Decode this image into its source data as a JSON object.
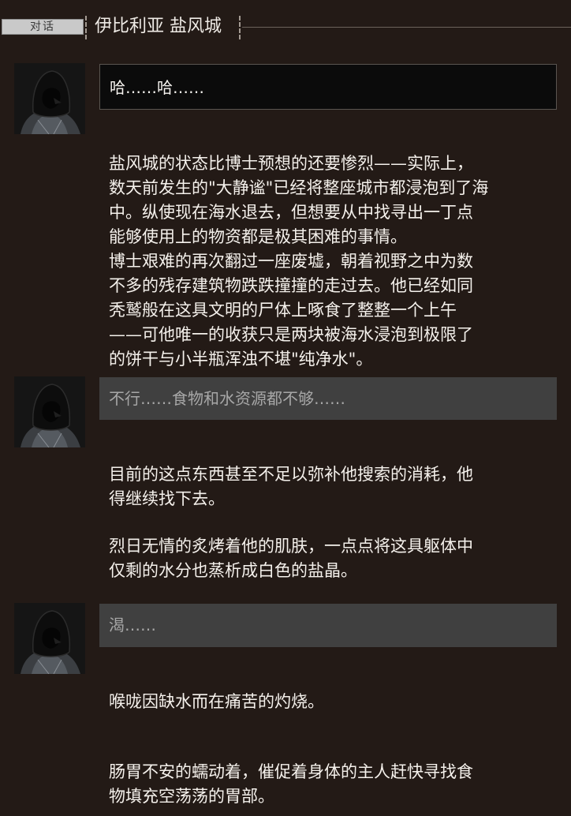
{
  "header": {
    "tag_label": "对话",
    "location": "伊比利亚 盐风城"
  },
  "dialogue": [
    {
      "line": "哈……哈……"
    },
    {
      "line": "不行……食物和水资源都不够……"
    },
    {
      "line": "渴……"
    }
  ],
  "narration": [
    [
      "盐风城的状态比博士预想的还要惨烈——实际上，",
      "数天前发生的\"大静谧\"已经将整座城市都浸泡到了海",
      "中。纵使现在海水退去，但想要从中找寻出一丁点",
      "能够使用上的物资都是极其困难的事情。",
      "博士艰难的再次翻过一座废墟，朝着视野之中为数",
      "不多的残存建筑物跌跌撞撞的走过去。他已经如同",
      "秃鹫般在这具文明的尸体上啄食了整整一个上午",
      "——可他唯一的收获只是两块被海水浸泡到极限了",
      "的饼干与小半瓶浑浊不堪\"纯净水\"。"
    ],
    [
      "目前的这点东西甚至不足以弥补他搜索的消耗，他",
      "得继续找下去。"
    ],
    [
      "烈日无情的炙烤着他的肌肤，一点点将这具躯体中",
      "仅剩的水分也蒸析成白色的盐晶。"
    ],
    [
      "喉咙因缺水而在痛苦的灼烧。"
    ],
    [
      "肠胃不安的蠕动着，催促着身体的主人赶快寻找食",
      "物填充空荡荡的胃部。"
    ]
  ]
}
